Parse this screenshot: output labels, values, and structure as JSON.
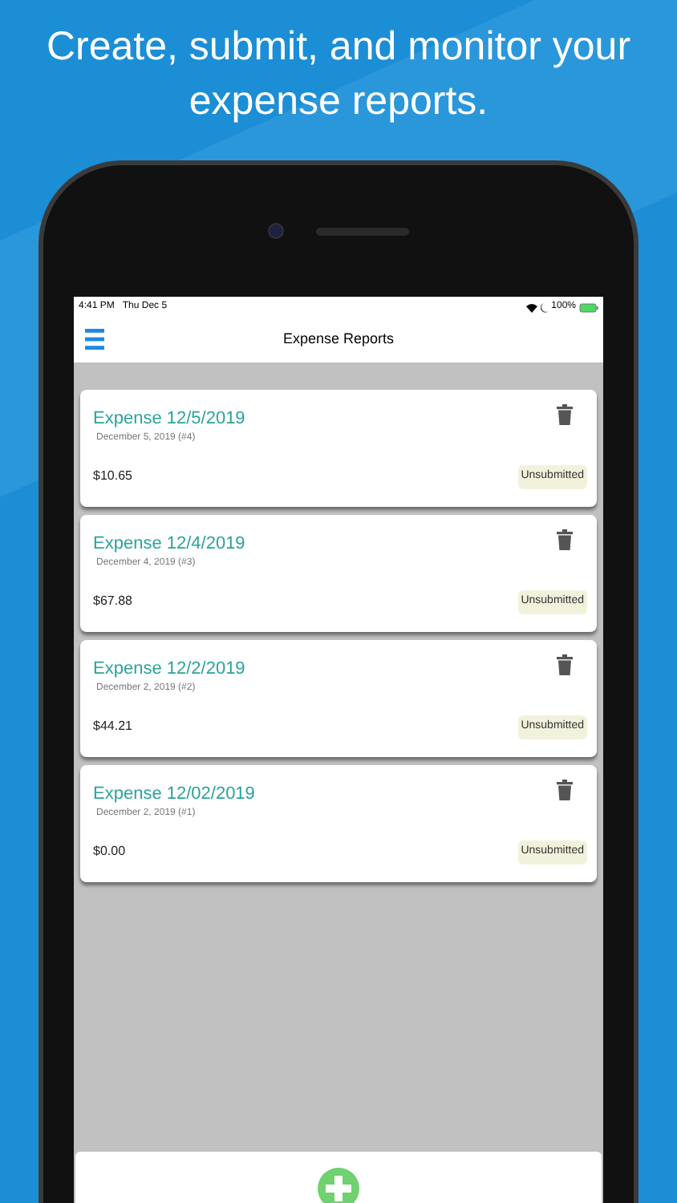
{
  "headline": "Create, submit, and monitor your expense reports.",
  "status_bar": {
    "time": "4:41 PM",
    "date": "Thu Dec 5",
    "battery": "100%"
  },
  "nav": {
    "title": "Expense Reports"
  },
  "reports": [
    {
      "title": "Expense 12/5/2019",
      "subtitle": "December 5, 2019 (#4)",
      "amount": "$10.65",
      "status": "Unsubmitted"
    },
    {
      "title": "Expense 12/4/2019",
      "subtitle": "December 4, 2019 (#3)",
      "amount": "$67.88",
      "status": "Unsubmitted"
    },
    {
      "title": "Expense 12/2/2019",
      "subtitle": "December 2, 2019 (#2)",
      "amount": "$44.21",
      "status": "Unsubmitted"
    },
    {
      "title": "Expense 12/02/2019",
      "subtitle": "December 2, 2019 (#1)",
      "amount": "$0.00",
      "status": "Unsubmitted"
    }
  ]
}
